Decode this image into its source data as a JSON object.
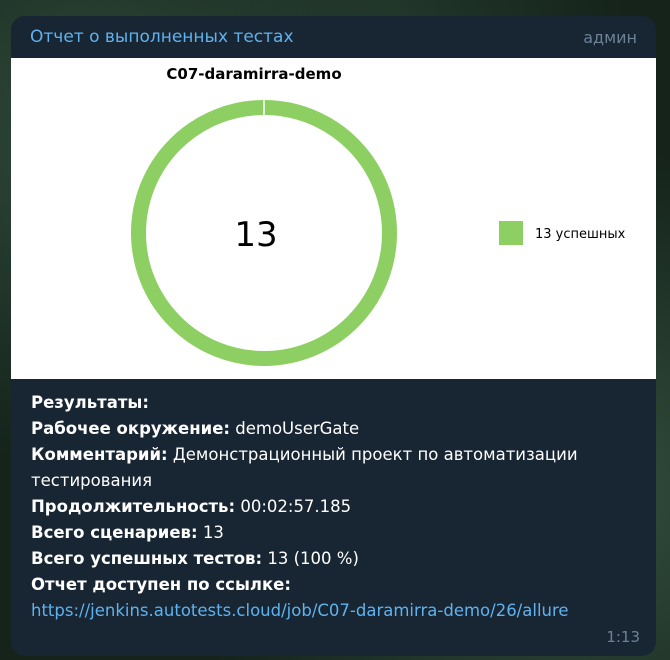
{
  "message": {
    "sender": "Отчет о выполненных тестах",
    "badge": "админ",
    "time": "1:13"
  },
  "chart_data": {
    "type": "pie",
    "variant": "donut",
    "title": "C07-daramirra-demo",
    "center_label": "13",
    "slices": [
      {
        "label": "13 успешных",
        "value": 13,
        "color": "#8ecf63"
      }
    ],
    "legend_position": "right"
  },
  "report": {
    "results_label": "Результаты:",
    "env_label": "Рабочее окружение:",
    "env_value": "demoUserGate",
    "comment_label": "Комментарий:",
    "comment_value": "Демонстрационный проект по автоматизации тестирования",
    "duration_label": "Продолжительность:",
    "duration_value": "00:02:57.185",
    "scenarios_label": "Всего сценариев:",
    "scenarios_value": "13",
    "passed_label": "Всего успешных тестов:",
    "passed_value": "13 (100 %)",
    "link_label": "Отчет доступен по ссылке:",
    "link_url": "https://jenkins.autotests.cloud/job/C07-daramirra-demo/26/allure"
  },
  "colors": {
    "bubble": "#182533",
    "link": "#5fb2ee",
    "muted": "#6d8295",
    "success": "#8ecf63"
  }
}
